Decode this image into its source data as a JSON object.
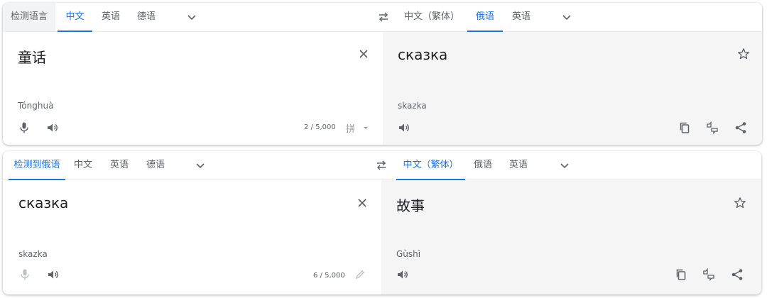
{
  "card1": {
    "source_tabs": [
      "检测语言",
      "中文",
      "英语",
      "德语"
    ],
    "target_tabs": [
      "中文（繁体）",
      "俄语",
      "英语"
    ],
    "source_text": "童话",
    "source_phonetic": "Tónghuà",
    "char_count": "2 / 5,000",
    "ime_label": "拼",
    "target_text": "сказка",
    "target_phonetic": "skazka"
  },
  "card2": {
    "source_tabs": [
      "检测到俄语",
      "中文",
      "英语",
      "德语"
    ],
    "target_tabs": [
      "中文（繁体）",
      "俄语",
      "英语"
    ],
    "source_text": "сказка",
    "source_phonetic": "skazka",
    "char_count": "6 / 5,000",
    "target_text": "故事",
    "target_phonetic": "Gùshì"
  },
  "icons": [
    "chevron-down-icon",
    "swap-icon",
    "close-icon",
    "star-icon",
    "microphone-icon",
    "speaker-icon",
    "copy-icon",
    "feedback-icon",
    "share-icon",
    "pencil-icon"
  ],
  "colors": {
    "accent": "#1a73e8",
    "icon": "#5f6368",
    "target_bg": "#f5f5f5",
    "tab_gray": "#f1f3f4"
  }
}
